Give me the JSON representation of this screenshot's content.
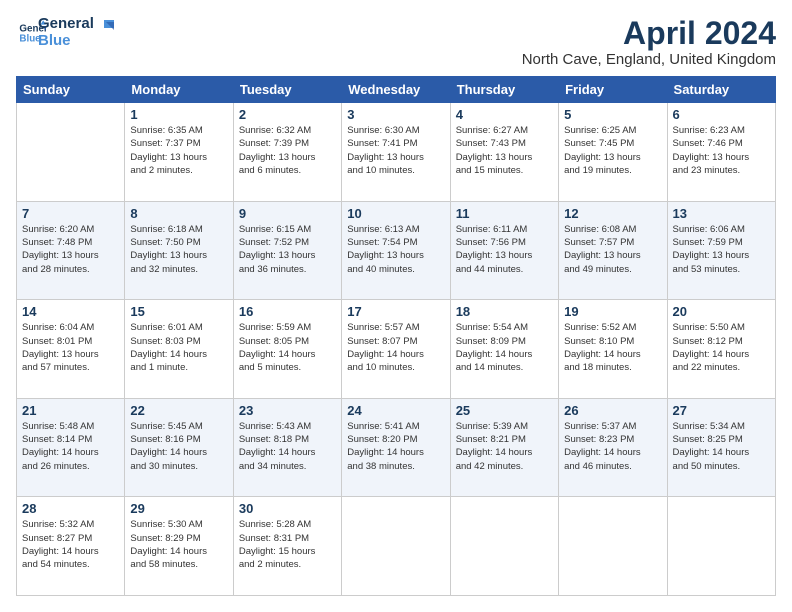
{
  "header": {
    "logo_line1": "General",
    "logo_line2": "Blue",
    "title": "April 2024",
    "location": "North Cave, England, United Kingdom"
  },
  "days_of_week": [
    "Sunday",
    "Monday",
    "Tuesday",
    "Wednesday",
    "Thursday",
    "Friday",
    "Saturday"
  ],
  "weeks": [
    [
      {
        "day": "",
        "lines": []
      },
      {
        "day": "1",
        "lines": [
          "Sunrise: 6:35 AM",
          "Sunset: 7:37 PM",
          "Daylight: 13 hours",
          "and 2 minutes."
        ]
      },
      {
        "day": "2",
        "lines": [
          "Sunrise: 6:32 AM",
          "Sunset: 7:39 PM",
          "Daylight: 13 hours",
          "and 6 minutes."
        ]
      },
      {
        "day": "3",
        "lines": [
          "Sunrise: 6:30 AM",
          "Sunset: 7:41 PM",
          "Daylight: 13 hours",
          "and 10 minutes."
        ]
      },
      {
        "day": "4",
        "lines": [
          "Sunrise: 6:27 AM",
          "Sunset: 7:43 PM",
          "Daylight: 13 hours",
          "and 15 minutes."
        ]
      },
      {
        "day": "5",
        "lines": [
          "Sunrise: 6:25 AM",
          "Sunset: 7:45 PM",
          "Daylight: 13 hours",
          "and 19 minutes."
        ]
      },
      {
        "day": "6",
        "lines": [
          "Sunrise: 6:23 AM",
          "Sunset: 7:46 PM",
          "Daylight: 13 hours",
          "and 23 minutes."
        ]
      }
    ],
    [
      {
        "day": "7",
        "lines": [
          "Sunrise: 6:20 AM",
          "Sunset: 7:48 PM",
          "Daylight: 13 hours",
          "and 28 minutes."
        ]
      },
      {
        "day": "8",
        "lines": [
          "Sunrise: 6:18 AM",
          "Sunset: 7:50 PM",
          "Daylight: 13 hours",
          "and 32 minutes."
        ]
      },
      {
        "day": "9",
        "lines": [
          "Sunrise: 6:15 AM",
          "Sunset: 7:52 PM",
          "Daylight: 13 hours",
          "and 36 minutes."
        ]
      },
      {
        "day": "10",
        "lines": [
          "Sunrise: 6:13 AM",
          "Sunset: 7:54 PM",
          "Daylight: 13 hours",
          "and 40 minutes."
        ]
      },
      {
        "day": "11",
        "lines": [
          "Sunrise: 6:11 AM",
          "Sunset: 7:56 PM",
          "Daylight: 13 hours",
          "and 44 minutes."
        ]
      },
      {
        "day": "12",
        "lines": [
          "Sunrise: 6:08 AM",
          "Sunset: 7:57 PM",
          "Daylight: 13 hours",
          "and 49 minutes."
        ]
      },
      {
        "day": "13",
        "lines": [
          "Sunrise: 6:06 AM",
          "Sunset: 7:59 PM",
          "Daylight: 13 hours",
          "and 53 minutes."
        ]
      }
    ],
    [
      {
        "day": "14",
        "lines": [
          "Sunrise: 6:04 AM",
          "Sunset: 8:01 PM",
          "Daylight: 13 hours",
          "and 57 minutes."
        ]
      },
      {
        "day": "15",
        "lines": [
          "Sunrise: 6:01 AM",
          "Sunset: 8:03 PM",
          "Daylight: 14 hours",
          "and 1 minute."
        ]
      },
      {
        "day": "16",
        "lines": [
          "Sunrise: 5:59 AM",
          "Sunset: 8:05 PM",
          "Daylight: 14 hours",
          "and 5 minutes."
        ]
      },
      {
        "day": "17",
        "lines": [
          "Sunrise: 5:57 AM",
          "Sunset: 8:07 PM",
          "Daylight: 14 hours",
          "and 10 minutes."
        ]
      },
      {
        "day": "18",
        "lines": [
          "Sunrise: 5:54 AM",
          "Sunset: 8:09 PM",
          "Daylight: 14 hours",
          "and 14 minutes."
        ]
      },
      {
        "day": "19",
        "lines": [
          "Sunrise: 5:52 AM",
          "Sunset: 8:10 PM",
          "Daylight: 14 hours",
          "and 18 minutes."
        ]
      },
      {
        "day": "20",
        "lines": [
          "Sunrise: 5:50 AM",
          "Sunset: 8:12 PM",
          "Daylight: 14 hours",
          "and 22 minutes."
        ]
      }
    ],
    [
      {
        "day": "21",
        "lines": [
          "Sunrise: 5:48 AM",
          "Sunset: 8:14 PM",
          "Daylight: 14 hours",
          "and 26 minutes."
        ]
      },
      {
        "day": "22",
        "lines": [
          "Sunrise: 5:45 AM",
          "Sunset: 8:16 PM",
          "Daylight: 14 hours",
          "and 30 minutes."
        ]
      },
      {
        "day": "23",
        "lines": [
          "Sunrise: 5:43 AM",
          "Sunset: 8:18 PM",
          "Daylight: 14 hours",
          "and 34 minutes."
        ]
      },
      {
        "day": "24",
        "lines": [
          "Sunrise: 5:41 AM",
          "Sunset: 8:20 PM",
          "Daylight: 14 hours",
          "and 38 minutes."
        ]
      },
      {
        "day": "25",
        "lines": [
          "Sunrise: 5:39 AM",
          "Sunset: 8:21 PM",
          "Daylight: 14 hours",
          "and 42 minutes."
        ]
      },
      {
        "day": "26",
        "lines": [
          "Sunrise: 5:37 AM",
          "Sunset: 8:23 PM",
          "Daylight: 14 hours",
          "and 46 minutes."
        ]
      },
      {
        "day": "27",
        "lines": [
          "Sunrise: 5:34 AM",
          "Sunset: 8:25 PM",
          "Daylight: 14 hours",
          "and 50 minutes."
        ]
      }
    ],
    [
      {
        "day": "28",
        "lines": [
          "Sunrise: 5:32 AM",
          "Sunset: 8:27 PM",
          "Daylight: 14 hours",
          "and 54 minutes."
        ]
      },
      {
        "day": "29",
        "lines": [
          "Sunrise: 5:30 AM",
          "Sunset: 8:29 PM",
          "Daylight: 14 hours",
          "and 58 minutes."
        ]
      },
      {
        "day": "30",
        "lines": [
          "Sunrise: 5:28 AM",
          "Sunset: 8:31 PM",
          "Daylight: 15 hours",
          "and 2 minutes."
        ]
      },
      {
        "day": "",
        "lines": []
      },
      {
        "day": "",
        "lines": []
      },
      {
        "day": "",
        "lines": []
      },
      {
        "day": "",
        "lines": []
      }
    ]
  ]
}
